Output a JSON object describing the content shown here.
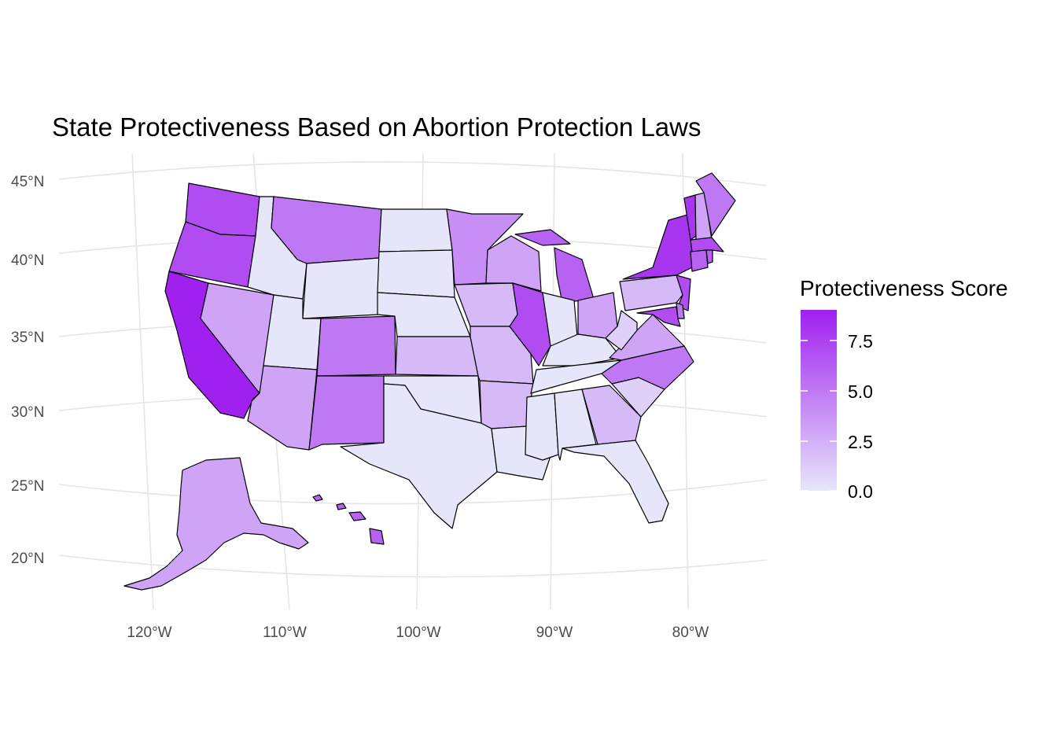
{
  "title": "State Protectiveness Based on Abortion Protection Laws",
  "colors": {
    "low": "#E6E6FA",
    "high": "#A020F0",
    "background": "#ffffff",
    "grid": "#e5e5e5",
    "border": "#000000"
  },
  "axes": {
    "lat_labels": [
      "45°N",
      "40°N",
      "35°N",
      "30°N",
      "25°N",
      "20°N"
    ],
    "lon_labels": [
      "120°W",
      "110°W",
      "100°W",
      "90°W",
      "80°W"
    ]
  },
  "legend": {
    "title": "Protectiveness Score",
    "labels": [
      "7.5",
      "5.0",
      "2.5",
      "0.0"
    ],
    "range": [
      0,
      9
    ]
  },
  "chart_data": {
    "type": "choropleth",
    "title": "State Protectiveness Based on Abortion Protection Laws",
    "value_label": "Protectiveness Score",
    "scale": {
      "min": 0,
      "max": 9,
      "low_color": "#E6E6FA",
      "high_color": "#A020F0"
    },
    "states": [
      {
        "state": "Washington",
        "value": 7
      },
      {
        "state": "Oregon",
        "value": 7
      },
      {
        "state": "California",
        "value": 9
      },
      {
        "state": "Nevada",
        "value": 3
      },
      {
        "state": "Idaho",
        "value": 0
      },
      {
        "state": "Montana",
        "value": 5
      },
      {
        "state": "Wyoming",
        "value": 0
      },
      {
        "state": "Utah",
        "value": 0
      },
      {
        "state": "Arizona",
        "value": 3
      },
      {
        "state": "Colorado",
        "value": 5
      },
      {
        "state": "New Mexico",
        "value": 5
      },
      {
        "state": "North Dakota",
        "value": 0
      },
      {
        "state": "South Dakota",
        "value": 0
      },
      {
        "state": "Nebraska",
        "value": 0
      },
      {
        "state": "Kansas",
        "value": 2
      },
      {
        "state": "Oklahoma",
        "value": 0
      },
      {
        "state": "Texas",
        "value": 0
      },
      {
        "state": "Minnesota",
        "value": 4
      },
      {
        "state": "Iowa",
        "value": 2
      },
      {
        "state": "Missouri",
        "value": 2
      },
      {
        "state": "Arkansas",
        "value": 2
      },
      {
        "state": "Louisiana",
        "value": 0
      },
      {
        "state": "Wisconsin",
        "value": 3
      },
      {
        "state": "Illinois",
        "value": 7
      },
      {
        "state": "Michigan",
        "value": 6
      },
      {
        "state": "Indiana",
        "value": 0
      },
      {
        "state": "Ohio",
        "value": 3
      },
      {
        "state": "Kentucky",
        "value": 0
      },
      {
        "state": "Tennessee",
        "value": 0
      },
      {
        "state": "Mississippi",
        "value": 0
      },
      {
        "state": "Alabama",
        "value": 0
      },
      {
        "state": "Georgia",
        "value": 2
      },
      {
        "state": "Florida",
        "value": 0
      },
      {
        "state": "South Carolina",
        "value": 1
      },
      {
        "state": "North Carolina",
        "value": 5
      },
      {
        "state": "Virginia",
        "value": 3
      },
      {
        "state": "West Virginia",
        "value": 1
      },
      {
        "state": "Pennsylvania",
        "value": 2
      },
      {
        "state": "New York",
        "value": 8
      },
      {
        "state": "Vermont",
        "value": 8
      },
      {
        "state": "New Hampshire",
        "value": 3
      },
      {
        "state": "Maine",
        "value": 5
      },
      {
        "state": "Massachusetts",
        "value": 7
      },
      {
        "state": "Connecticut",
        "value": 6
      },
      {
        "state": "Rhode Island",
        "value": 6
      },
      {
        "state": "New Jersey",
        "value": 7
      },
      {
        "state": "Delaware",
        "value": 5
      },
      {
        "state": "Maryland",
        "value": 7
      },
      {
        "state": "Alaska",
        "value": 3
      },
      {
        "state": "Hawaii",
        "value": 6
      }
    ]
  }
}
